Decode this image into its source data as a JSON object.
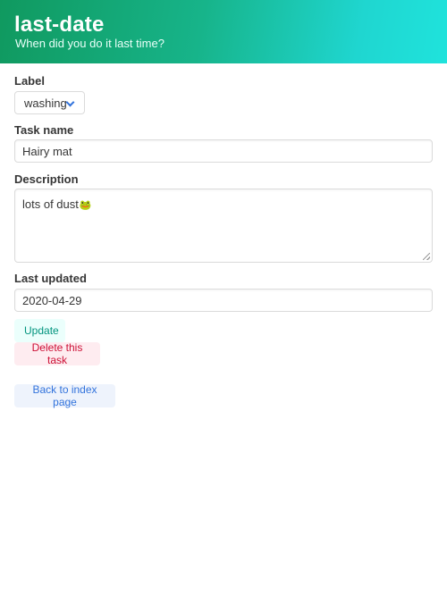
{
  "header": {
    "title": "last-date",
    "subtitle": "When did you do it last time?"
  },
  "form": {
    "label_field": {
      "label": "Label",
      "selected": "washing"
    },
    "task_name": {
      "label": "Task name",
      "value": "Hairy mat"
    },
    "description": {
      "label": "Description",
      "value": "lots of dust",
      "emoji": "🐸"
    },
    "last_updated": {
      "label": "Last updated",
      "value": "2020-04-29"
    }
  },
  "buttons": {
    "update": "Update",
    "delete": "Delete this task",
    "back": "Back to index page"
  },
  "colors": {
    "header_gradient_start": "#10995f",
    "header_gradient_end": "#1fe3dc",
    "update_text": "#00947e",
    "delete_text": "#cc0f35",
    "back_text": "#3273dc"
  }
}
